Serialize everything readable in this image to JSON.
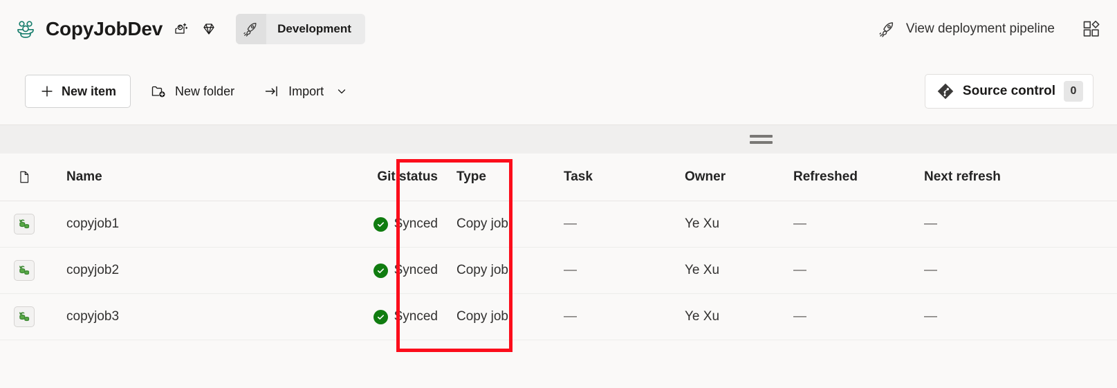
{
  "topbar": {
    "workspace_icon": "workspace-people-icon",
    "workspace_title": "CopyJobDev",
    "title_icons": [
      {
        "name": "ai-sparkle-icon"
      },
      {
        "name": "diamond-capacity-icon"
      }
    ],
    "env_badge": {
      "icon": "rocket-icon",
      "label": "Development"
    },
    "pipeline_button": {
      "icon": "rocket-icon",
      "label": "View deployment pipeline"
    },
    "apps_icon": "apps-grid-icon"
  },
  "commandbar": {
    "new_item": {
      "icon": "plus-icon",
      "label": "New item"
    },
    "new_folder": {
      "icon": "new-folder-icon",
      "label": "New folder"
    },
    "import": {
      "icon": "import-arrow-icon",
      "label": "Import",
      "chevron": "chevron-down-icon"
    },
    "source_control": {
      "icon": "git-logo-icon",
      "label": "Source control",
      "count": "0"
    }
  },
  "resize_handle": {
    "name": "pane-resize-handle"
  },
  "table": {
    "columns": {
      "icon": "",
      "name": "Name",
      "git_status": "Git status",
      "type": "Type",
      "task": "Task",
      "owner": "Owner",
      "refreshed": "Refreshed",
      "next_refresh": "Next refresh"
    },
    "header_icon": "document-column-icon",
    "rows": [
      {
        "icon": "copy-job-icon",
        "name": "copyjob1",
        "git_status": "Synced",
        "git_status_icon": "check-circle-icon",
        "type": "Copy job",
        "task": "—",
        "owner": "Ye Xu",
        "refreshed": "—",
        "next_refresh": "—"
      },
      {
        "icon": "copy-job-icon",
        "name": "copyjob2",
        "git_status": "Synced",
        "git_status_icon": "check-circle-icon",
        "type": "Copy job",
        "task": "—",
        "owner": "Ye Xu",
        "refreshed": "—",
        "next_refresh": "—"
      },
      {
        "icon": "copy-job-icon",
        "name": "copyjob3",
        "git_status": "Synced",
        "git_status_icon": "check-circle-icon",
        "type": "Copy job",
        "task": "—",
        "owner": "Ye Xu",
        "refreshed": "—",
        "next_refresh": "—"
      }
    ]
  },
  "annotation": {
    "name": "git-status-highlight",
    "color": "#fc0d1b"
  },
  "colors": {
    "page_background": "#faf9f8",
    "synced_green": "#107c10",
    "workspace_icon_teal": "#1a7f6e",
    "highlight_red": "#fc0d1b",
    "strip_gray": "#f0efee"
  }
}
